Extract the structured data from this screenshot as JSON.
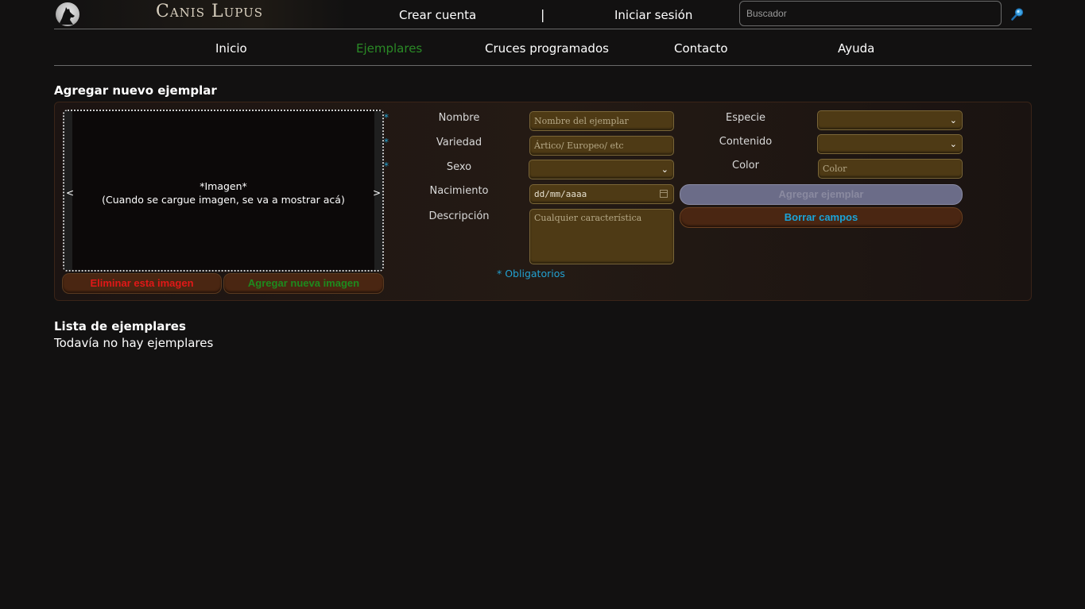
{
  "header": {
    "brand_name": "Canis Lupus",
    "create_account": "Crear cuenta",
    "separator": "|",
    "login": "Iniciar sesión",
    "search_placeholder": "Buscador"
  },
  "nav": {
    "items": [
      {
        "label": "Inicio",
        "active": false
      },
      {
        "label": "Ejemplares",
        "active": true
      },
      {
        "label": "Cruces programados",
        "active": false
      },
      {
        "label": "Contacto",
        "active": false
      },
      {
        "label": "Ayuda",
        "active": false
      }
    ],
    "active_color": "#2a8a26"
  },
  "form": {
    "title": "Agregar nuevo ejemplar",
    "image": {
      "prev": "<",
      "next": ">",
      "placeholder_line1": "*Imagen*",
      "placeholder_line2": "(Cuando se cargue imagen, se va a mostrar acá)",
      "delete_button": "Eliminar esta imagen",
      "add_button": "Agregar nueva imagen"
    },
    "required_mark": "*",
    "labels": {
      "nombre": "Nombre",
      "variedad": "Variedad",
      "sexo": "Sexo",
      "nacimiento": "Nacimiento",
      "descripcion": "Descripción",
      "especie": "Especie",
      "contenido": "Contenido",
      "color": "Color"
    },
    "placeholders": {
      "nombre": "Nombre del ejemplar",
      "variedad": "Ártico/ Europeo/ etc",
      "nacimiento": "dd/mm/aaaa",
      "descripcion": "Cualquier característica",
      "color": "Color"
    },
    "selects": {
      "sexo": "",
      "especie": "",
      "contenido": ""
    },
    "submit_button": "Agregar ejemplar",
    "clear_button": "Borrar campos",
    "required_note": "* Obligatorios",
    "accent_color": "#22a0d0"
  },
  "list": {
    "title": "Lista de ejemplares",
    "empty_text": "Todavía no hay ejemplares"
  }
}
